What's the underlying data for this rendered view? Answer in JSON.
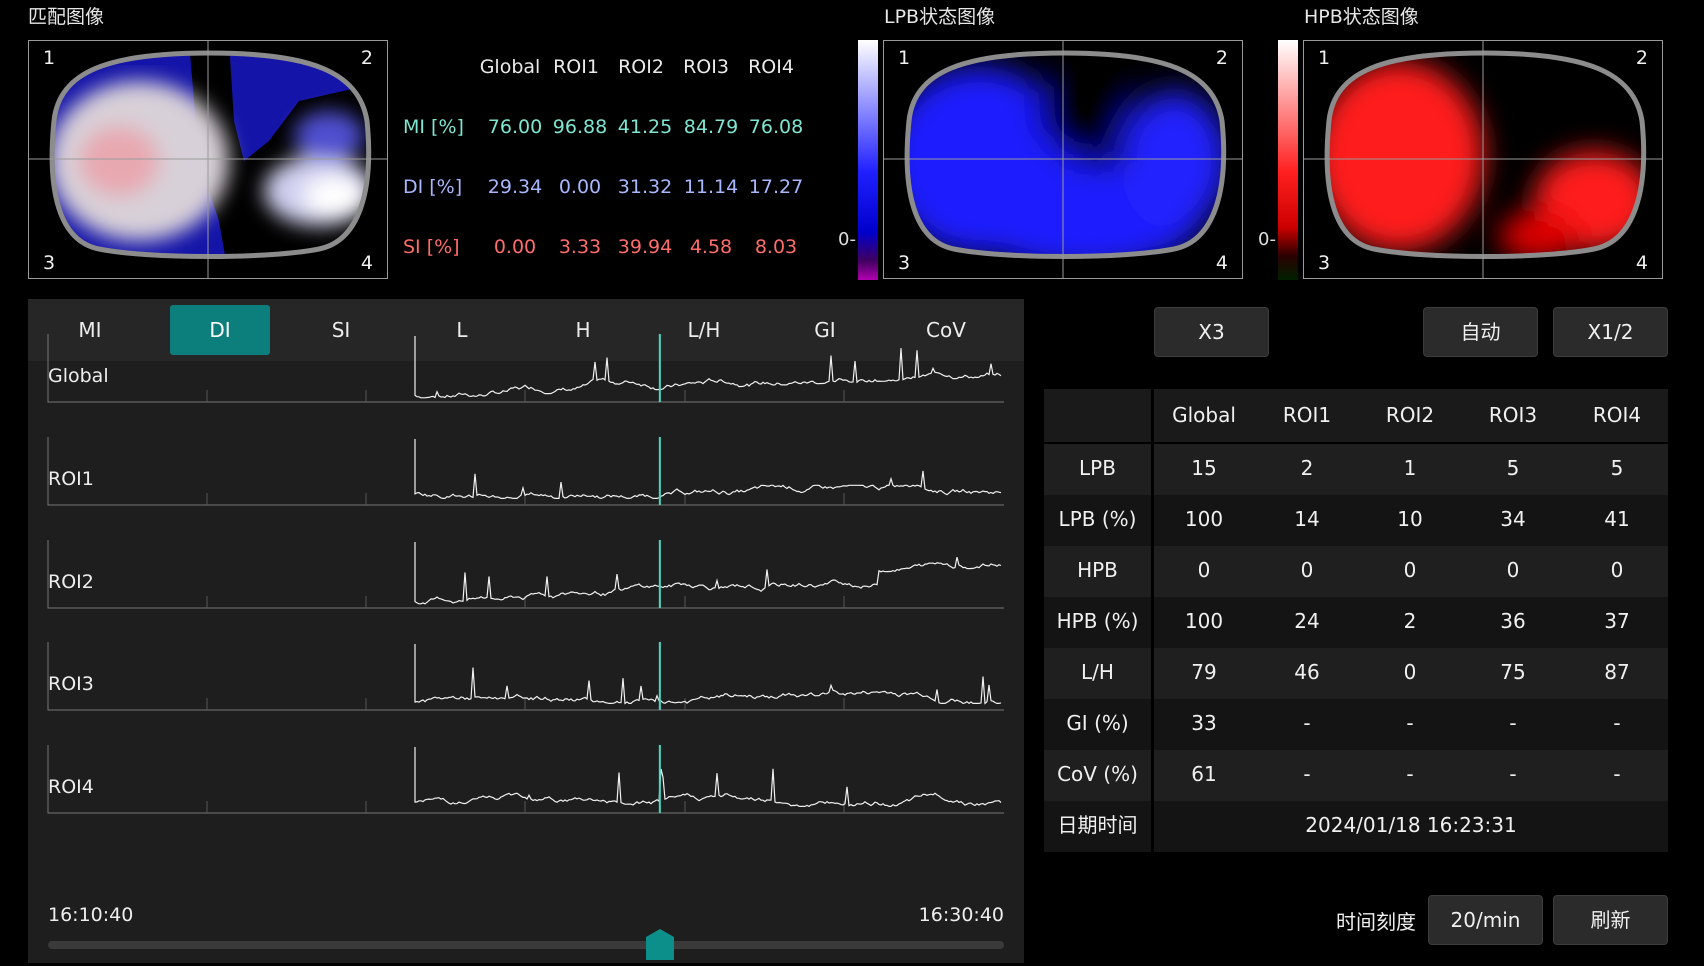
{
  "titles": {
    "match_image": "匹配图像",
    "lpb_image": "LPB状态图像",
    "hpb_image": "HPB状态图像"
  },
  "corners": [
    "1",
    "2",
    "3",
    "4"
  ],
  "colorbar_zero": "0-",
  "metrics": {
    "headers": [
      "Global",
      "ROI1",
      "ROI2",
      "ROI3",
      "ROI4"
    ],
    "rows": [
      {
        "label": "MI [%]",
        "values": [
          "76.00",
          "96.88",
          "41.25",
          "84.79",
          "76.08"
        ],
        "color": "#7fe6d2"
      },
      {
        "label": "DI [%]",
        "values": [
          "29.34",
          "0.00",
          "31.32",
          "11.14",
          "17.27"
        ],
        "color": "#a9b7ff"
      },
      {
        "label": "SI [%]",
        "values": [
          "0.00",
          "3.33",
          "39.94",
          "4.58",
          "8.03"
        ],
        "color": "#ff6c6c"
      }
    ]
  },
  "tabs": [
    "MI",
    "DI",
    "SI",
    "L",
    "H",
    "L/H",
    "GI",
    "CoV"
  ],
  "active_tab": "DI",
  "charts": [
    "Global",
    "ROI1",
    "ROI2",
    "ROI3",
    "ROI4"
  ],
  "time_start": "16:10:40",
  "time_end": "16:30:40",
  "slider_position": 0.64,
  "buttons": {
    "x3": "X3",
    "auto": "自动",
    "x_half": "X1/2",
    "time_scale_label": "时间刻度",
    "time_scale_value": "20/min",
    "refresh": "刷新"
  },
  "table": {
    "headers": [
      "",
      "Global",
      "ROI1",
      "ROI2",
      "ROI3",
      "ROI4"
    ],
    "rows": [
      {
        "label": "LPB",
        "values": [
          "15",
          "2",
          "1",
          "5",
          "5"
        ]
      },
      {
        "label": "LPB (%)",
        "values": [
          "100",
          "14",
          "10",
          "34",
          "41"
        ]
      },
      {
        "label": "HPB",
        "values": [
          "0",
          "0",
          "0",
          "0",
          "0"
        ]
      },
      {
        "label": "HPB (%)",
        "values": [
          "100",
          "24",
          "2",
          "36",
          "37"
        ]
      },
      {
        "label": "L/H",
        "values": [
          "79",
          "46",
          "0",
          "75",
          "87"
        ]
      },
      {
        "label": "GI (%)",
        "values": [
          "33",
          "-",
          "-",
          "-",
          "-"
        ]
      },
      {
        "label": "CoV (%)",
        "values": [
          "61",
          "-",
          "-",
          "-",
          "-"
        ]
      }
    ],
    "datetime_label": "日期时间",
    "datetime_value": "2024/01/18 16:23:31"
  },
  "colors": {
    "accent": "#0c7f7c",
    "cursor": "#49d8c4",
    "lpb": "#1a1aff",
    "hpb": "#ff1a1a"
  }
}
